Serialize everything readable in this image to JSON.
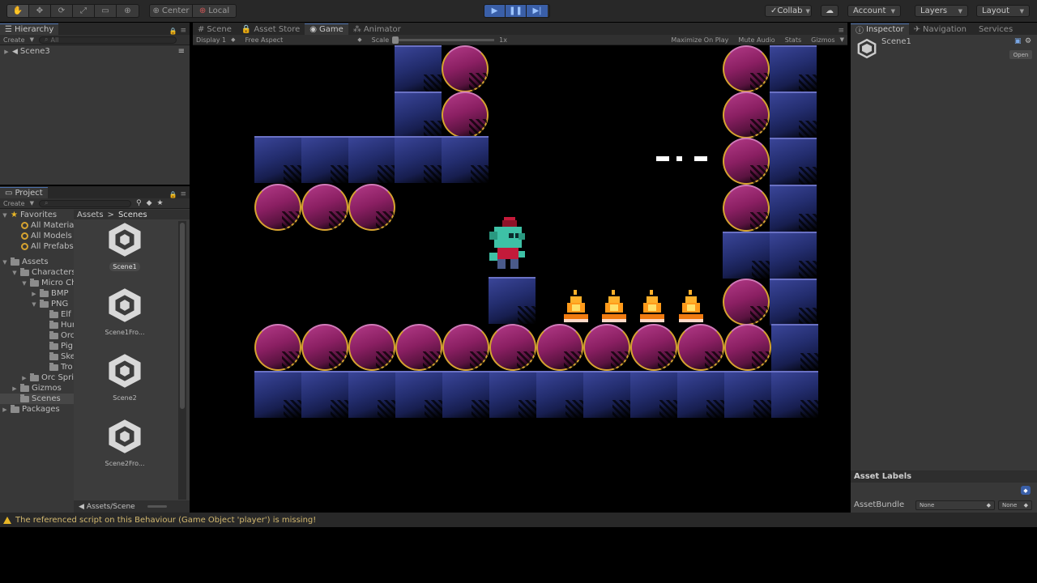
{
  "toolbar": {
    "pivot_center": "Center",
    "pivot_local": "Local",
    "collab": "Collab",
    "account": "Account",
    "layers": "Layers",
    "layout": "Layout"
  },
  "scene_tabs": {
    "scene": "Scene",
    "asset_store": "Asset Store",
    "game": "Game",
    "animator": "Animator"
  },
  "game_bar": {
    "display": "Display 1",
    "aspect": "Free Aspect",
    "scale_label": "Scale",
    "scale_value": "1x",
    "maximize": "Maximize On Play",
    "mute": "Mute Audio",
    "stats": "Stats",
    "gizmos": "Gizmos"
  },
  "hierarchy": {
    "tab": "Hierarchy",
    "create": "Create",
    "search_placeholder": "All",
    "scene": "Scene3"
  },
  "project": {
    "tab": "Project",
    "create": "Create",
    "favorites_label": "Favorites",
    "favorites": [
      "All Material",
      "All Models",
      "All Prefabs"
    ],
    "assets_label": "Assets",
    "tree": [
      {
        "label": "Characters",
        "depth": 1,
        "arrow": "▼"
      },
      {
        "label": "Micro Ch",
        "depth": 2,
        "arrow": "▼"
      },
      {
        "label": "BMP",
        "depth": 3,
        "arrow": "▶"
      },
      {
        "label": "PNG",
        "depth": 3,
        "arrow": "▼"
      },
      {
        "label": "Elf",
        "depth": 4,
        "arrow": ""
      },
      {
        "label": "Hur",
        "depth": 4,
        "arrow": ""
      },
      {
        "label": "Orc",
        "depth": 4,
        "arrow": ""
      },
      {
        "label": "Pig",
        "depth": 4,
        "arrow": ""
      },
      {
        "label": "Ske",
        "depth": 4,
        "arrow": ""
      },
      {
        "label": "Tro",
        "depth": 4,
        "arrow": ""
      },
      {
        "label": "Orc Spri",
        "depth": 2,
        "arrow": "▶"
      },
      {
        "label": "Gizmos",
        "depth": 1,
        "arrow": "▶"
      },
      {
        "label": "Scenes",
        "depth": 1,
        "arrow": ""
      }
    ],
    "packages_label": "Packages",
    "breadcrumb_root": "Assets",
    "breadcrumb_sep": ">",
    "breadcrumb_current": "Scenes",
    "scenes": [
      "Scene1",
      "Scene1Fro...",
      "Scene2",
      "Scene2Fro..."
    ],
    "footer_path": "Assets/Scene"
  },
  "inspector": {
    "tabs": [
      "Inspector",
      "Navigation",
      "Services"
    ],
    "scene_name": "Scene1",
    "open_button": "Open",
    "asset_labels": "Asset Labels",
    "asset_bundle_label": "AssetBundle",
    "bundle_value": "None",
    "variant_value": "None"
  },
  "status": {
    "message": "The referenced script on this Behaviour (Game Object 'player') is missing!"
  },
  "colors": {
    "accent": "#4a6ea8",
    "tile_blue": "#2a3580",
    "tile_magenta": "#9a2a73",
    "warning": "#e7b627"
  }
}
